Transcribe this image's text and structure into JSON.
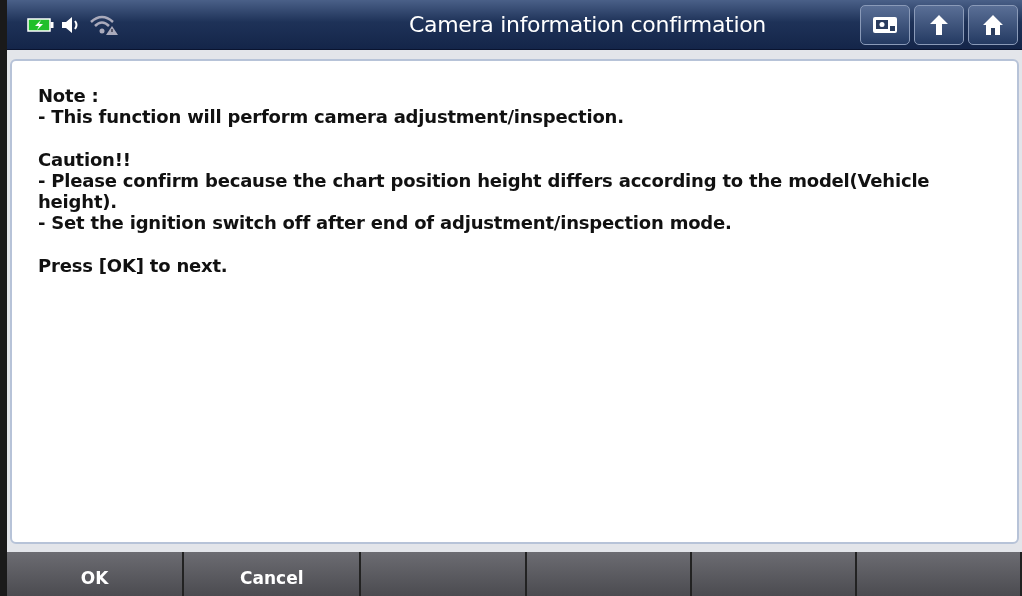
{
  "window": {
    "title": "Camera information confirmation"
  },
  "message": [
    [
      "Note :",
      "- This function will perform camera adjustment/inspection."
    ],
    [
      "Caution!!",
      "- Please confirm because the chart position height differs according to the model(Vehicle height).",
      "- Set the ignition switch off after end of adjustment/inspection mode."
    ],
    [
      "Press [OK] to next."
    ]
  ],
  "buttons": [
    "OK",
    "Cancel"
  ]
}
